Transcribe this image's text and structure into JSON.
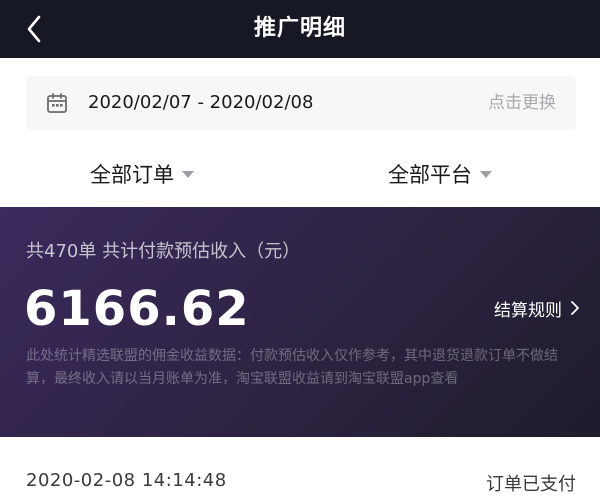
{
  "header": {
    "title": "推广明细",
    "back_icon": "chevron-left-icon"
  },
  "date_filter": {
    "icon": "calendar-icon",
    "range": "2020/02/07 - 2020/02/08",
    "action_label": "点击更换"
  },
  "filters": [
    {
      "label": "全部订单",
      "icon": "caret-down-icon"
    },
    {
      "label": "全部平台",
      "icon": "caret-down-icon"
    }
  ],
  "income": {
    "summary": "共470单 共计付款预估收入（元）",
    "amount": "6166.62",
    "settle_rule_label": "结算规则",
    "settle_rule_icon": "chevron-right-icon",
    "note": "此处统计精选联盟的佣金收益数据：付款预估收入仅作参考，其中退货退款订单不做结算，最终收入请以当月账单为准，淘宝联盟收益请到淘宝联盟app查看"
  },
  "orders": [
    {
      "time": "2020-02-08 14:14:48",
      "status": "订单已支付"
    }
  ],
  "colors": {
    "header_bg": "#161823",
    "panel_gradient_start": "#3b2a5d",
    "panel_gradient_end": "#1f1c2c",
    "muted_text": "#a9a9ad"
  }
}
